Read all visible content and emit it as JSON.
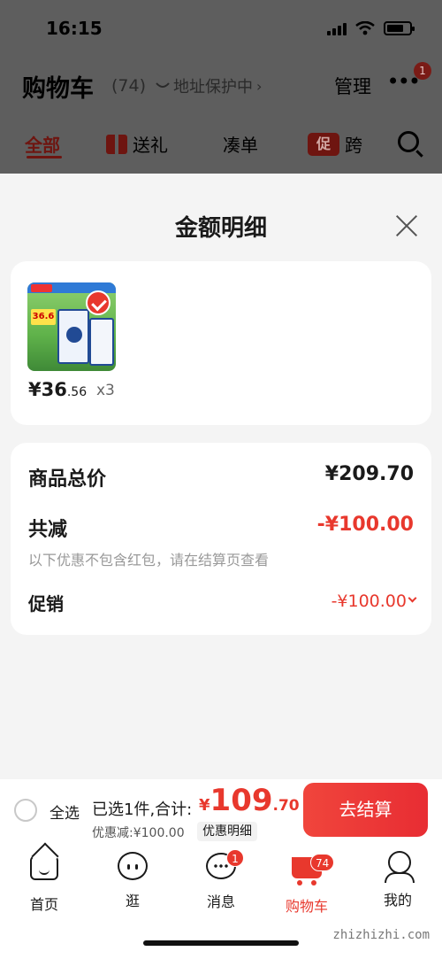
{
  "status_bar": {
    "time": "16:15"
  },
  "header": {
    "title": "购物车",
    "count": "(74)",
    "address": "地址保护中",
    "manage": "管理",
    "more_badge": "1"
  },
  "tabs": [
    {
      "label": "全部"
    },
    {
      "label": "送礼"
    },
    {
      "label": "凑单"
    },
    {
      "label": "跨",
      "badge": "促"
    }
  ],
  "sheet": {
    "title": "金额明细",
    "product": {
      "price_int": "¥36",
      "price_dec": ".56",
      "qty": "x3",
      "image_price_tag": "36.6"
    },
    "summary": {
      "total_label": "商品总价",
      "total_value": "¥209.70",
      "reduce_label": "共减",
      "reduce_value": "-¥100.00",
      "note": "以下优惠不包含红包，请在结算页查看",
      "promo_label": "促销",
      "promo_value": "-¥100.00"
    }
  },
  "checkout": {
    "select_all": "全选",
    "selected_text": "已选1件,合计:",
    "total_currency": "¥",
    "total_int": "109",
    "total_dec": ".70",
    "discount_line": "优惠减:¥100.00",
    "detail_chip": "优惠明细",
    "button": "去结算"
  },
  "nav": [
    {
      "label": "首页",
      "icon": "home-icon"
    },
    {
      "label": "逛",
      "icon": "explore-face-icon"
    },
    {
      "label": "消息",
      "icon": "message-icon",
      "badge": "1"
    },
    {
      "label": "购物车",
      "icon": "cart-icon",
      "badge": "74",
      "active": true
    },
    {
      "label": "我的",
      "icon": "profile-icon"
    }
  ],
  "watermark": "zhizhizhi.com",
  "colors": {
    "accent": "#e8382d",
    "overlay": "#5e5e5e",
    "sheet_bg": "#f4f4f4"
  }
}
